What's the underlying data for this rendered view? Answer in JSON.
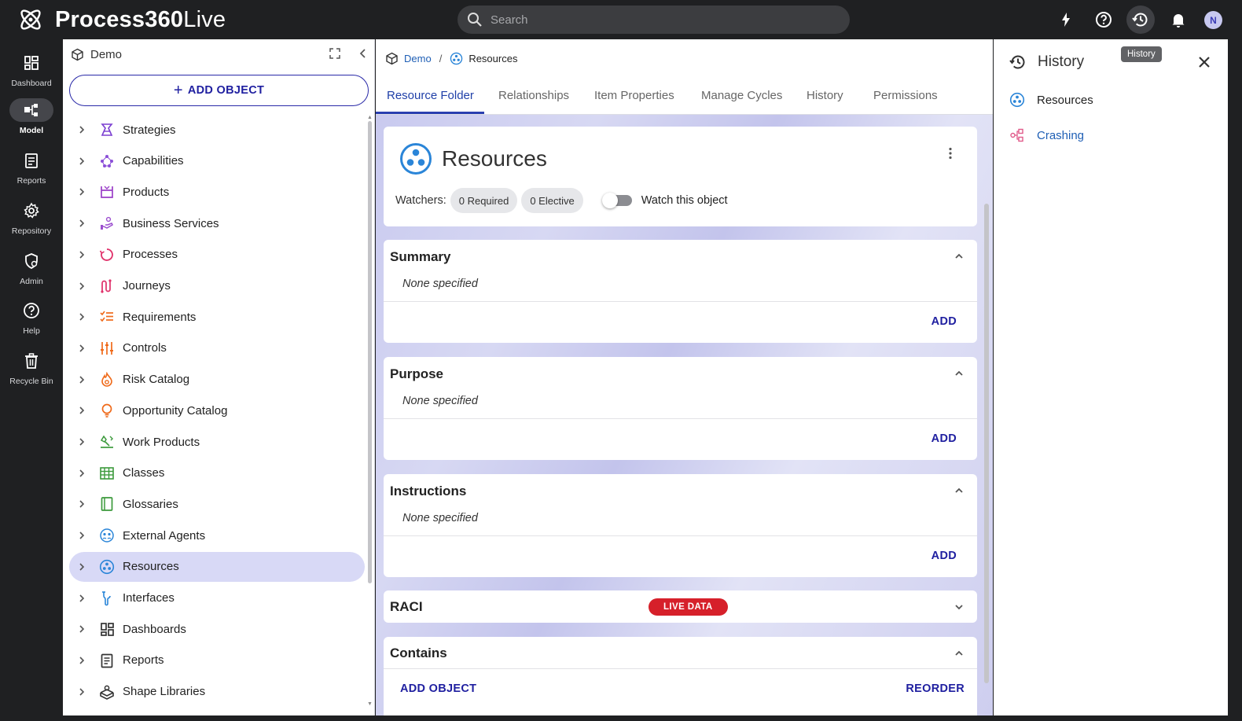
{
  "app": {
    "logo_bold": "Process360",
    "logo_light": "Live"
  },
  "search": {
    "placeholder": "Search"
  },
  "topbar": {
    "avatar_initial": "N"
  },
  "nav": [
    {
      "label": "Dashboard",
      "icon": "dashboard-icon"
    },
    {
      "label": "Model",
      "icon": "model-icon"
    },
    {
      "label": "Reports",
      "icon": "reports-icon"
    },
    {
      "label": "Repository",
      "icon": "gear-icon"
    },
    {
      "label": "Admin",
      "icon": "admin-shield-icon"
    },
    {
      "label": "Help",
      "icon": "help-icon"
    },
    {
      "label": "Recycle Bin",
      "icon": "trash-icon"
    }
  ],
  "tree": {
    "root": "Demo",
    "add_object": "ADD OBJECT",
    "items": [
      {
        "label": "Strategies",
        "icon": "strategies-icon",
        "color": "#7b3fd1"
      },
      {
        "label": "Capabilities",
        "icon": "capabilities-icon",
        "color": "#8b4fd8"
      },
      {
        "label": "Products",
        "icon": "products-icon",
        "color": "#9b3fc8"
      },
      {
        "label": "Business Services",
        "icon": "business-services-icon",
        "color": "#9c4fcf"
      },
      {
        "label": "Processes",
        "icon": "processes-icon",
        "color": "#e0306a"
      },
      {
        "label": "Journeys",
        "icon": "journeys-icon",
        "color": "#e0306a"
      },
      {
        "label": "Requirements",
        "icon": "requirements-icon",
        "color": "#ef6a1a"
      },
      {
        "label": "Controls",
        "icon": "controls-icon",
        "color": "#ef6a1a"
      },
      {
        "label": "Risk Catalog",
        "icon": "risk-icon",
        "color": "#ef6a1a"
      },
      {
        "label": "Opportunity Catalog",
        "icon": "lightbulb-icon",
        "color": "#ef6a1a"
      },
      {
        "label": "Work Products",
        "icon": "work-products-icon",
        "color": "#3c9a3c"
      },
      {
        "label": "Classes",
        "icon": "classes-icon",
        "color": "#3c9a3c"
      },
      {
        "label": "Glossaries",
        "icon": "glossary-icon",
        "color": "#3c9a3c"
      },
      {
        "label": "External Agents",
        "icon": "external-agents-icon",
        "color": "#2a85d8"
      },
      {
        "label": "Resources",
        "icon": "resources-icon",
        "color": "#2a85d8"
      },
      {
        "label": "Interfaces",
        "icon": "interfaces-icon",
        "color": "#2a85d8"
      },
      {
        "label": "Dashboards",
        "icon": "dashboards-icon",
        "color": "#333"
      },
      {
        "label": "Reports",
        "icon": "reports-icon",
        "color": "#333"
      },
      {
        "label": "Shape Libraries",
        "icon": "shape-libraries-icon",
        "color": "#333"
      }
    ],
    "selected": "Resources"
  },
  "breadcrumb": {
    "root": "Demo",
    "separator": "/",
    "current": "Resources"
  },
  "tabs": [
    "Resource Folder",
    "Relationships",
    "Item Properties",
    "Manage Cycles",
    "History",
    "Permissions"
  ],
  "object": {
    "title": "Resources",
    "watchers_label": "Watchers:",
    "required_chip": "0 Required",
    "elective_chip": "0 Elective",
    "watch_label": "Watch this object"
  },
  "sections": {
    "summary": {
      "title": "Summary",
      "value": "None specified",
      "action": "ADD"
    },
    "purpose": {
      "title": "Purpose",
      "value": "None specified",
      "action": "ADD"
    },
    "instructions": {
      "title": "Instructions",
      "value": "None specified",
      "action": "ADD"
    },
    "raci": {
      "title": "RACI",
      "badge": "LIVE DATA"
    },
    "contains": {
      "title": "Contains",
      "add": "ADD OBJECT",
      "reorder": "REORDER"
    }
  },
  "history_panel": {
    "title": "History",
    "tooltip": "History",
    "items": [
      {
        "label": "Resources",
        "color": "#222"
      },
      {
        "label": "Crashing",
        "color": "#1f5fb5"
      }
    ]
  },
  "colors": {
    "accent": "#1f1fa0",
    "selected_bg": "#d8d9f6",
    "live_badge": "#d6202a"
  }
}
